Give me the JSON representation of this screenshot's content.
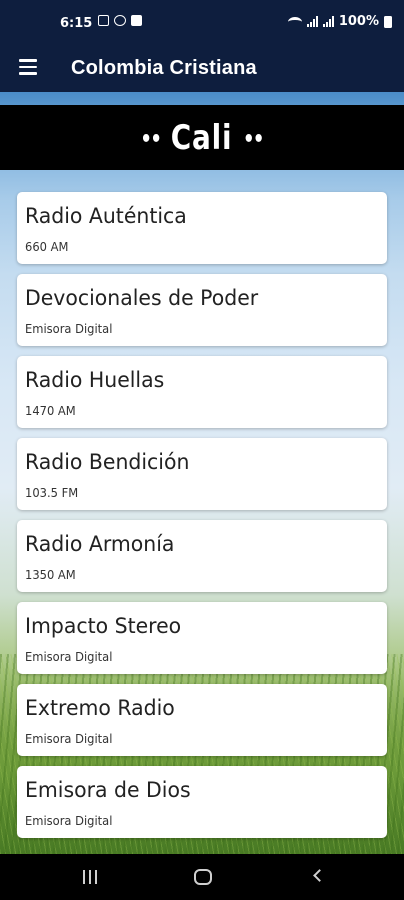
{
  "status_bar": {
    "time": "6:15",
    "battery": "100%",
    "left_icons": [
      "image-icon",
      "cast-icon",
      "app-icon"
    ],
    "right_icons": [
      "wifi-icon",
      "signal-icon",
      "signal-icon",
      "battery-icon"
    ]
  },
  "app_bar": {
    "title": "Colombia Cristiana",
    "menu_icon": "menu-icon"
  },
  "banner": {
    "dots_left": "••",
    "city": "Cali",
    "dots_right": "••"
  },
  "stations": [
    {
      "name": "Radio Auténtica",
      "sub": "660 AM"
    },
    {
      "name": "Devocionales de Poder",
      "sub": "Emisora Digital"
    },
    {
      "name": "Radio Huellas",
      "sub": "1470 AM"
    },
    {
      "name": "Radio Bendición",
      "sub": "103.5 FM"
    },
    {
      "name": "Radio Armonía",
      "sub": "1350 AM"
    },
    {
      "name": "Impacto Stereo",
      "sub": "Emisora Digital"
    },
    {
      "name": "Extremo Radio",
      "sub": "Emisora Digital"
    },
    {
      "name": "Emisora de Dios",
      "sub": "Emisora Digital"
    }
  ],
  "nav_bar": {
    "icons": [
      "recent-apps-icon",
      "home-icon",
      "back-icon"
    ]
  },
  "colors": {
    "app_bar": "#0e1e3e",
    "banner": "#000000",
    "card": "#ffffff"
  }
}
